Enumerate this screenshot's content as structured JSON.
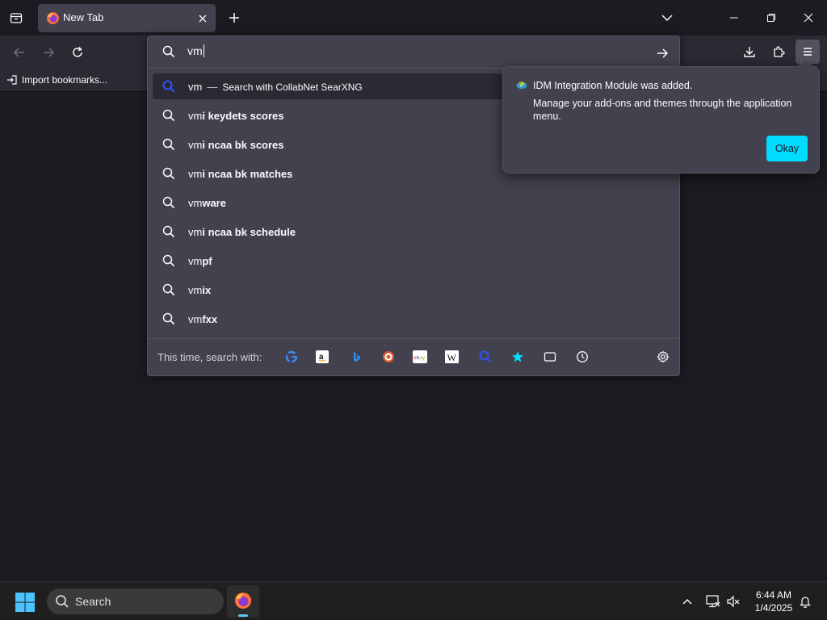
{
  "browser": {
    "tab": {
      "title": "New Tab"
    },
    "bookmarks_bar": {
      "import_label": "Import bookmarks..."
    }
  },
  "urlbar": {
    "input_value": "vm",
    "selected": {
      "query": "vm",
      "separator": "—",
      "action": "Search with CollabNet SearXNG"
    },
    "suggestions": [
      {
        "typed": "vm",
        "completion": "i keydets scores"
      },
      {
        "typed": "vm",
        "completion": "i ncaa bk scores"
      },
      {
        "typed": "vm",
        "completion": "i ncaa bk matches"
      },
      {
        "typed": "vm",
        "completion": "ware"
      },
      {
        "typed": "vm",
        "completion": "i ncaa bk schedule"
      },
      {
        "typed": "vm",
        "completion": "pf"
      },
      {
        "typed": "vm",
        "completion": "ix"
      },
      {
        "typed": "vm",
        "completion": "fxx"
      }
    ],
    "one_off_label": "This time, search with:",
    "engines": [
      "google-icon",
      "amazon-icon",
      "bing-icon",
      "duckduckgo-icon",
      "ebay-icon",
      "wikipedia-icon",
      "searxng-icon",
      "bookmarks-icon",
      "tabs-icon",
      "history-icon"
    ]
  },
  "notification": {
    "title": "IDM Integration Module was added.",
    "body": "Manage your add-ons and themes through the application menu.",
    "button": "Okay"
  },
  "taskbar": {
    "search_label": "Search",
    "time": "6:44 AM",
    "date": "1/4/2025"
  },
  "colors": {
    "accent": "#00ddff",
    "toolbar": "#2b2a33",
    "panel": "#42414d",
    "background": "#1c1b22"
  }
}
